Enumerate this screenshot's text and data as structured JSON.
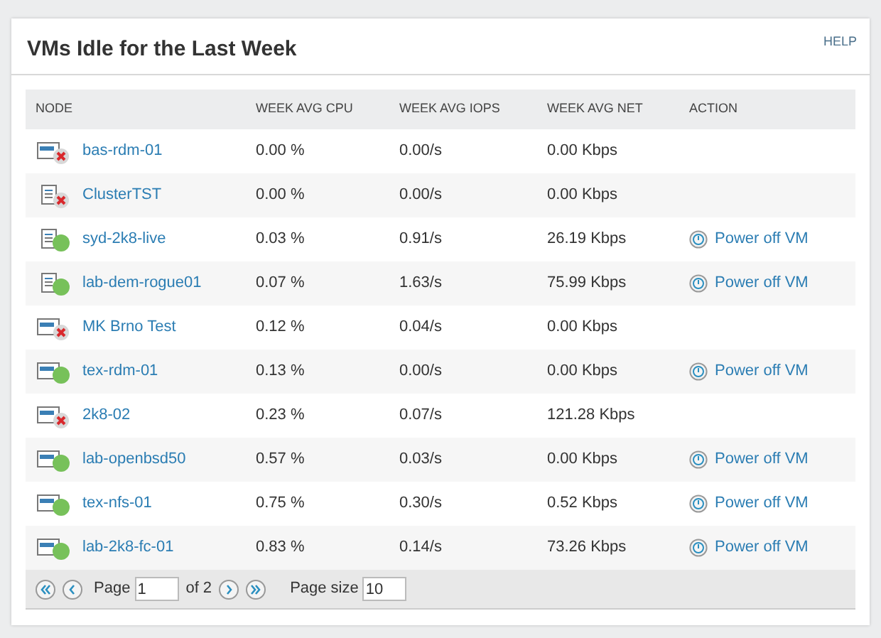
{
  "panel": {
    "title": "VMs Idle for the Last Week",
    "help": "HELP"
  },
  "table": {
    "columns": [
      "NODE",
      "WEEK AVG CPU",
      "WEEK AVG IOPS",
      "WEEK AVG NET",
      "ACTION"
    ],
    "rows": [
      {
        "node": "bas-rdm-01",
        "kind": "vm",
        "online": false,
        "cpu": "0.00 %",
        "iops": "0.00/s",
        "net": "0.00 Kbps"
      },
      {
        "node": "ClusterTST",
        "kind": "server",
        "online": false,
        "cpu": "0.00 %",
        "iops": "0.00/s",
        "net": "0.00 Kbps"
      },
      {
        "node": "syd-2k8-live",
        "kind": "server",
        "online": true,
        "cpu": "0.03 %",
        "iops": "0.91/s",
        "net": "26.19 Kbps",
        "action": "Power off VM"
      },
      {
        "node": "lab-dem-rogue01",
        "kind": "server",
        "online": true,
        "cpu": "0.07 %",
        "iops": "1.63/s",
        "net": "75.99 Kbps",
        "action": "Power off VM"
      },
      {
        "node": "MK Brno Test",
        "kind": "vm",
        "online": false,
        "cpu": "0.12 %",
        "iops": "0.04/s",
        "net": "0.00 Kbps"
      },
      {
        "node": "tex-rdm-01",
        "kind": "vm",
        "online": true,
        "cpu": "0.13 %",
        "iops": "0.00/s",
        "net": "0.00 Kbps",
        "action": "Power off VM"
      },
      {
        "node": "2k8-02",
        "kind": "vm",
        "online": false,
        "cpu": "0.23 %",
        "iops": "0.07/s",
        "net": "121.28 Kbps"
      },
      {
        "node": "lab-openbsd50",
        "kind": "vm",
        "online": true,
        "cpu": "0.57 %",
        "iops": "0.03/s",
        "net": "0.00 Kbps",
        "action": "Power off VM"
      },
      {
        "node": "tex-nfs-01",
        "kind": "vm",
        "online": true,
        "cpu": "0.75 %",
        "iops": "0.30/s",
        "net": "0.52 Kbps",
        "action": "Power off VM"
      },
      {
        "node": "lab-2k8-fc-01",
        "kind": "vm",
        "online": true,
        "cpu": "0.83 %",
        "iops": "0.14/s",
        "net": "73.26 Kbps",
        "action": "Power off VM"
      }
    ]
  },
  "pager": {
    "page_label": "Page",
    "page": "1",
    "of_label": "of 2",
    "size_label": "Page size",
    "size": "10"
  }
}
